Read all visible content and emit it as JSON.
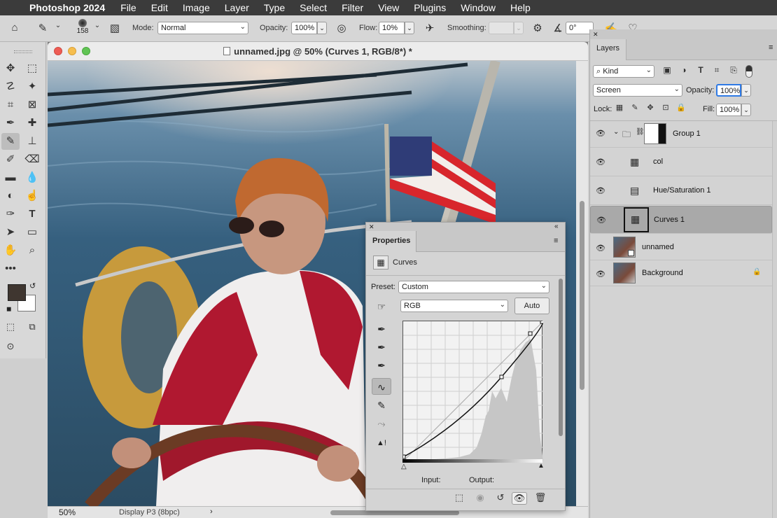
{
  "menubar": {
    "app_name": "Photoshop 2024",
    "items": [
      "File",
      "Edit",
      "Image",
      "Layer",
      "Type",
      "Select",
      "Filter",
      "View",
      "Plugins",
      "Window",
      "Help"
    ]
  },
  "options_bar": {
    "brush_size": "158",
    "mode_label": "Mode:",
    "mode_value": "Normal",
    "opacity_label": "Opacity:",
    "opacity_value": "100%",
    "flow_label": "Flow:",
    "flow_value": "10%",
    "smoothing_label": "Smoothing:",
    "angle_value": "0°"
  },
  "document": {
    "title": "unnamed.jpg @ 50% (Curves 1, RGB/8*) *",
    "zoom": "50%",
    "color_profile": "Display P3 (8bpc)"
  },
  "layers_panel": {
    "tab": "Layers",
    "filter_kind": "Kind",
    "blend_mode": "Screen",
    "opacity_label": "Opacity:",
    "opacity_value": "100%",
    "lock_label": "Lock:",
    "fill_label": "Fill:",
    "fill_value": "100%",
    "layers": [
      {
        "name": "Group 1",
        "type": "group"
      },
      {
        "name": "col",
        "type": "curves"
      },
      {
        "name": "Hue/Saturation 1",
        "type": "hue-saturation"
      },
      {
        "name": "Curves 1",
        "type": "curves",
        "selected": true
      },
      {
        "name": "unnamed",
        "type": "smart-object"
      },
      {
        "name": "Background",
        "type": "image",
        "locked": true
      }
    ]
  },
  "properties_panel": {
    "tab": "Properties",
    "adjustment_name": "Curves",
    "preset_label": "Preset:",
    "preset_value": "Custom",
    "channel_value": "RGB",
    "auto_button": "Auto",
    "input_label": "Input:",
    "output_label": "Output:"
  },
  "colors": {
    "foreground": "#3f3630",
    "background": "#ffffff",
    "selected_layer": "#a9a9a9"
  }
}
